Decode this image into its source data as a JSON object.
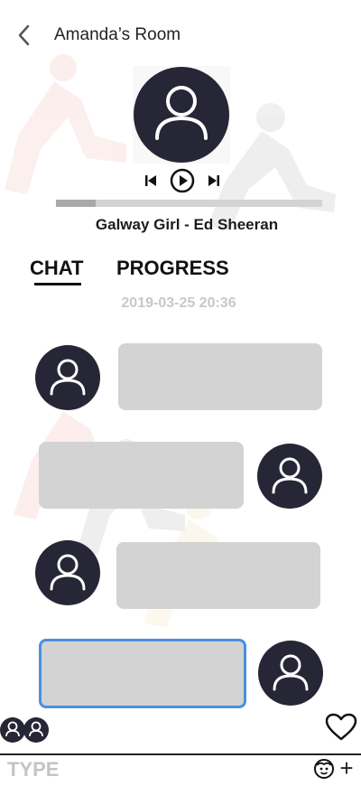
{
  "header": {
    "back_icon": "chevron-left-icon",
    "title": "Amanda’s Room"
  },
  "player": {
    "album_icon": "user-avatar-icon",
    "controls": [
      "skip-previous-icon",
      "play-icon",
      "skip-next-icon"
    ],
    "progress_fraction": 0.15,
    "song_title": "Galway Girl - Ed Sheeran"
  },
  "tabs": [
    {
      "label": "CHAT",
      "active": true
    },
    {
      "label": "PROGRESS",
      "active": false
    }
  ],
  "chat": {
    "timestamp": "2019-03-25 20:36",
    "messages": [
      {
        "side": "left",
        "text": ""
      },
      {
        "side": "right",
        "text": ""
      },
      {
        "side": "left",
        "text": ""
      },
      {
        "side": "right",
        "text": "",
        "focused": true
      }
    ]
  },
  "footer": {
    "participants_icon": "participants-icon",
    "heart_icon": "heart-icon",
    "input_placeholder": "TYPE",
    "emoji_icon": "emoji-icon",
    "plus_label": "+"
  },
  "colors": {
    "avatar_bg": "#262636",
    "bubble": "#d3d3d3",
    "focus_border": "#4a90e2",
    "progress_track": "#d3d3d3",
    "progress_fill": "#a9a9a9",
    "muted_text": "#c8c8c8"
  }
}
